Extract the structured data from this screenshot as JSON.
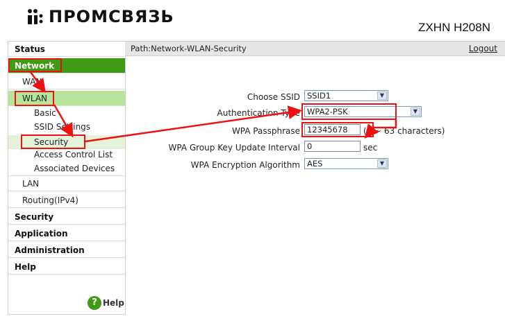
{
  "brand": {
    "logo_text": "ПРОМСВЯЗЬ",
    "model": "ZXHN H208N"
  },
  "colors": {
    "accent": "#3f9a16",
    "active_sub": "#b7e39a",
    "annotation": "#e11111"
  },
  "nav": {
    "status": "Status",
    "network": "Network",
    "wan": "WAN",
    "wlan": "WLAN",
    "basic": "Basic",
    "ssid_settings": "SSID Settings",
    "security": "Security",
    "acl": "Access Control List",
    "associated": "Associated Devices",
    "lan": "LAN",
    "routing": "Routing(IPv4)",
    "security_top": "Security",
    "application": "Application",
    "administration": "Administration",
    "help_top": "Help",
    "help_link": "Help"
  },
  "pathbar": {
    "path": "Path:Network-WLAN-Security",
    "logout": "Logout"
  },
  "form": {
    "choose_ssid": {
      "label": "Choose SSID",
      "value": "SSID1"
    },
    "auth_type": {
      "label": "Authentication Type",
      "value": "WPA2-PSK"
    },
    "passphrase": {
      "label": "WPA Passphrase",
      "value": "12345678",
      "hint": "(8 ~ 63 characters)"
    },
    "group_key": {
      "label": "WPA Group Key Update Interval",
      "value": "0",
      "unit": "sec"
    },
    "encryption": {
      "label": "WPA Encryption Algorithm",
      "value": "AES"
    }
  }
}
